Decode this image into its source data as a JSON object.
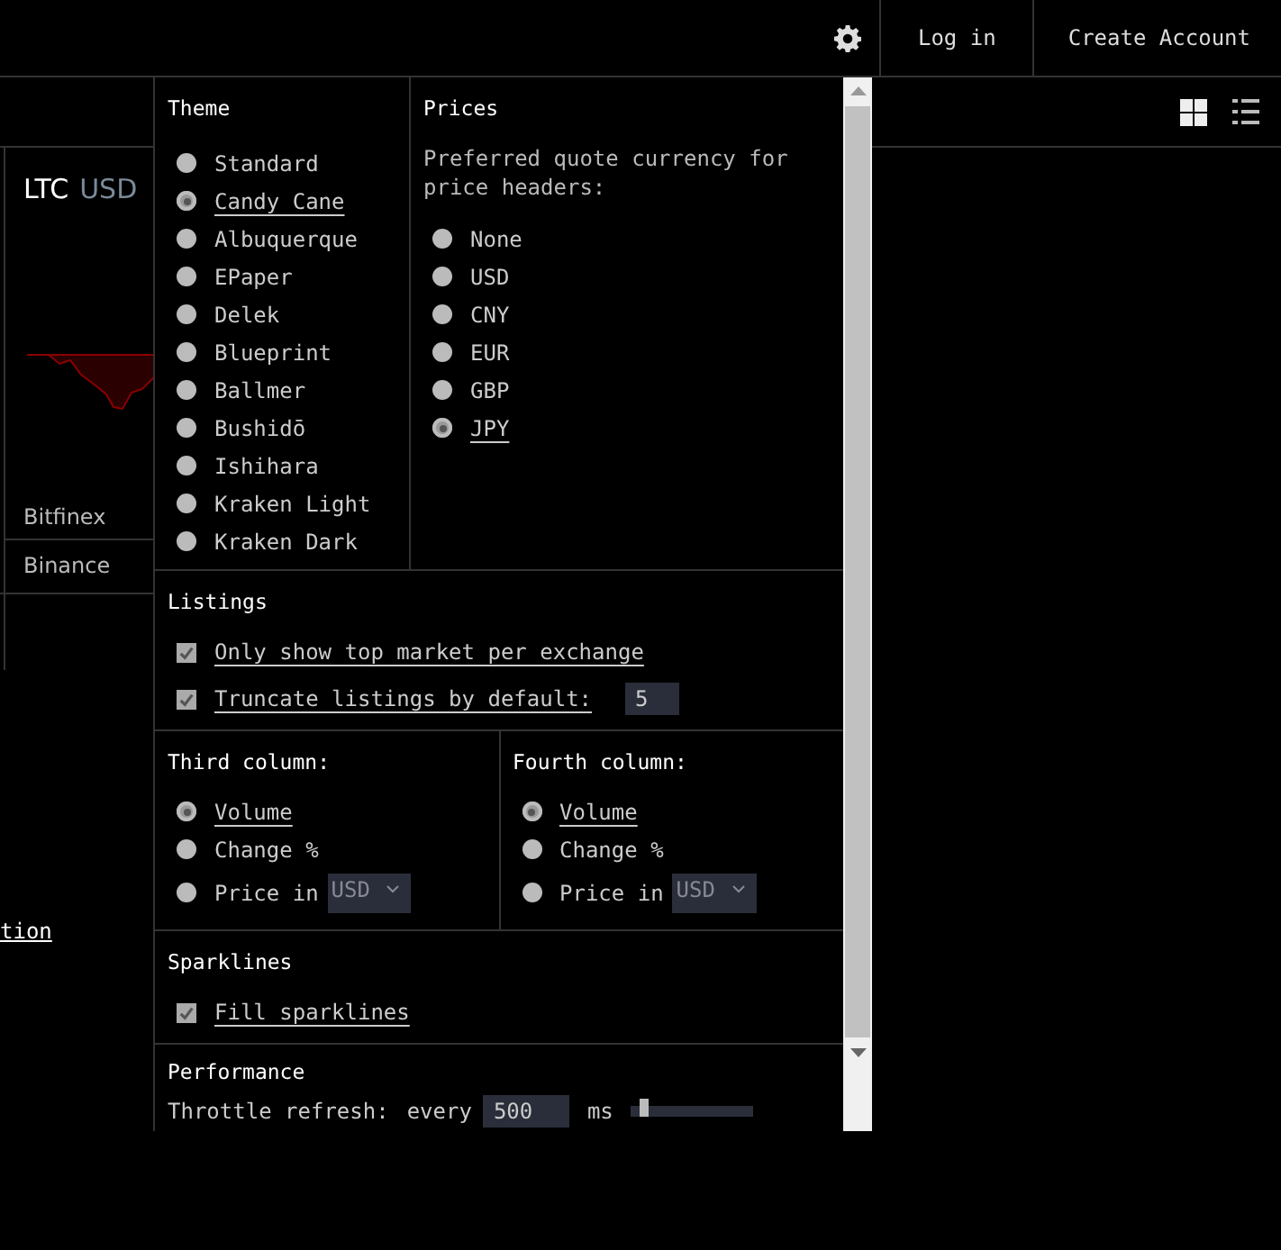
{
  "topbar": {
    "login": "Log in",
    "create_account": "Create Account"
  },
  "card": {
    "coin": "LTC",
    "quote": "USD",
    "exchanges": [
      "Bitfinex",
      "Binance"
    ]
  },
  "link_fragment": "tion",
  "settings": {
    "theme": {
      "title": "Theme",
      "options": [
        {
          "label": "Standard",
          "selected": false
        },
        {
          "label": "Candy Cane",
          "selected": true
        },
        {
          "label": "Albuquerque",
          "selected": false
        },
        {
          "label": "EPaper",
          "selected": false
        },
        {
          "label": "Delek",
          "selected": false
        },
        {
          "label": "Blueprint",
          "selected": false
        },
        {
          "label": "Ballmer",
          "selected": false
        },
        {
          "label": "Bushidō",
          "selected": false
        },
        {
          "label": "Ishihara",
          "selected": false
        },
        {
          "label": "Kraken Light",
          "selected": false
        },
        {
          "label": "Kraken Dark",
          "selected": false
        }
      ]
    },
    "prices": {
      "title": "Prices",
      "description": "Preferred quote currency for price headers:",
      "options": [
        {
          "label": "None",
          "selected": false
        },
        {
          "label": "USD",
          "selected": false
        },
        {
          "label": "CNY",
          "selected": false
        },
        {
          "label": "EUR",
          "selected": false
        },
        {
          "label": "GBP",
          "selected": false
        },
        {
          "label": "JPY",
          "selected": true
        }
      ]
    },
    "listings": {
      "title": "Listings",
      "options": [
        {
          "label": "Only show top market per exchange",
          "checked": true
        },
        {
          "label": "Truncate listings by default:",
          "checked": true,
          "value": "5"
        }
      ]
    },
    "columns": [
      {
        "title": "Third column:",
        "options": [
          {
            "label": "Volume",
            "selected": true
          },
          {
            "label": "Change %",
            "selected": false
          },
          {
            "label": "Price in",
            "selected": false,
            "currency": "USD"
          }
        ]
      },
      {
        "title": "Fourth column:",
        "options": [
          {
            "label": "Volume",
            "selected": true
          },
          {
            "label": "Change %",
            "selected": false
          },
          {
            "label": "Price in",
            "selected": false,
            "currency": "USD"
          }
        ]
      }
    ],
    "sparklines": {
      "title": "Sparklines",
      "options": [
        {
          "label": "Fill sparklines",
          "checked": true
        }
      ]
    },
    "performance": {
      "title": "Performance",
      "label": "Throttle refresh:",
      "prefix": "every",
      "value": "500",
      "unit": "ms",
      "level": 0.07
    }
  }
}
